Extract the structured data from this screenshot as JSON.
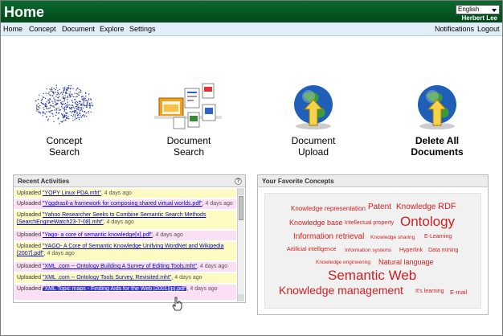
{
  "header": {
    "title": "Home",
    "language": "English",
    "user": "Herbert Lee"
  },
  "nav": {
    "left": [
      "Home",
      "Concept",
      "Document",
      "Explore",
      "Settings"
    ],
    "right": [
      "Notifications",
      "Logout"
    ]
  },
  "actions": [
    {
      "line1": "Concept",
      "line2": "Search",
      "icon": "scatter-cloud-icon"
    },
    {
      "line1": "Document",
      "line2": "Search",
      "icon": "document-files-icon"
    },
    {
      "line1": "Document",
      "line2": "Upload",
      "icon": "globe-upload-icon"
    },
    {
      "line1": "Delete All",
      "line2": "Documents",
      "icon": "globe-delete-icon"
    }
  ],
  "recent": {
    "title": "Recent Activities",
    "help": "?",
    "items": [
      {
        "verb": "Uploaded",
        "doc": "\"YOPY Linux PDA.mht\"",
        "ago": ", 4 days ago"
      },
      {
        "verb": "Uploaded",
        "doc": "\"Yggdrasil-a framework for composing shared virtual worlds.pdf\"",
        "ago": ", 4 days ago"
      },
      {
        "verb": "Uploaded",
        "doc": "\"Yahoo Researcher Seeks to Combine Semantic Search Methods [SearchEngineWatch23-7-08].mht\"",
        "ago": ", 4 days ago"
      },
      {
        "verb": "Uploaded",
        "doc": "\"Yago- a core of semantic knowledge[x].pdf\"",
        "ago": ", 4 days ago"
      },
      {
        "verb": "Uploaded",
        "doc": "\"YAGO- A Core of Semantic Knowledge Unifying WordNet and Wikipedia [2007].pdf\"",
        "ago": ", 4 days ago"
      },
      {
        "verb": "Uploaded",
        "doc": "\"XML .com -- Ontology Building  A Survey of Editing Tools.mht\"",
        "ago": ", 4 days ago"
      },
      {
        "verb": "Uploaded",
        "doc": "\"XML .com -- Ontology Tools Survey, Revisited.mht\"",
        "ago": ", 4 days ago"
      },
      {
        "verb": "Uploaded",
        "doc": "\"XML Topic maps - Finding Aids for the Web [2001][p].pdf\"",
        "ago": ", 4 days ago"
      }
    ]
  },
  "favorites": {
    "title": "Your Favorite Concepts",
    "tags": [
      "Knowledge representation",
      "Patent",
      "Knowledge",
      "RDF",
      "Knowledge base",
      "Intellectual property",
      "Ontology",
      "Information retrieval",
      "Knowledge sharing",
      "E-Learning",
      "Artificial intelligence",
      "Information systems",
      "Hyperlink",
      "Data mining",
      "Knowledge engineering",
      "Natural language",
      "Semantic Web",
      "Knowledge management",
      "It's learning",
      "E-mail"
    ],
    "color": "#d21e1e"
  },
  "colors": {
    "header": "#04471b",
    "nav": "#dfeef7",
    "highlight_yellow": "#fdfbc2",
    "highlight_pink": "#fbe0f5"
  }
}
